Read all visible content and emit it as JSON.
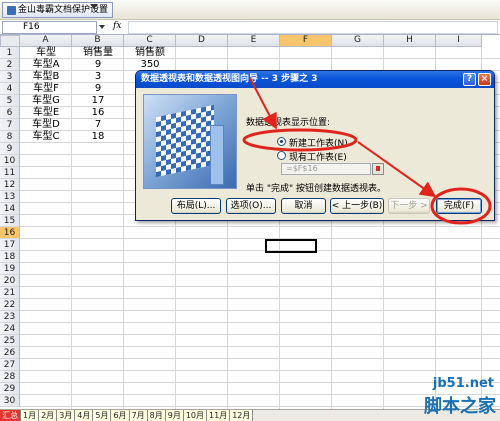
{
  "toolbar": {
    "protect_label": "金山毒霸文档保护设置"
  },
  "formula_bar": {
    "cell_ref": "F16",
    "fx_label": "fx",
    "formula": ""
  },
  "columns": [
    "A",
    "B",
    "C",
    "D",
    "E",
    "F",
    "G",
    "H",
    "I"
  ],
  "rows": [
    "1",
    "2",
    "3",
    "4",
    "5",
    "6",
    "7",
    "8",
    "9",
    "10",
    "11",
    "12",
    "13",
    "14",
    "15",
    "16",
    "17",
    "18",
    "19",
    "20",
    "21",
    "22",
    "23",
    "24",
    "25",
    "26",
    "27",
    "28",
    "29",
    "30"
  ],
  "selected": {
    "column": "F",
    "row": "16"
  },
  "sheet_data": {
    "headers": [
      "车型",
      "销售量",
      "销售额"
    ],
    "rows": [
      [
        "车型A",
        "9",
        "350"
      ],
      [
        "车型B",
        "3",
        ""
      ],
      [
        "车型F",
        "9",
        ""
      ],
      [
        "车型G",
        "17",
        ""
      ],
      [
        "车型E",
        "16",
        ""
      ],
      [
        "车型D",
        "7",
        ""
      ],
      [
        "车型C",
        "18",
        ""
      ]
    ]
  },
  "dialog": {
    "title": "数据透视表和数据透视图向导 -- 3 步骤之 3",
    "help_label": "?",
    "close_label": "×",
    "position_prompt": "数据透视表显示位置:",
    "options": [
      {
        "label": "新建工作表(N)",
        "selected": true
      },
      {
        "label": "现有工作表(E)",
        "selected": false
      }
    ],
    "range_value": "=$F$16",
    "hint": "单击 \"完成\" 按钮创建数据透视表。",
    "buttons": {
      "layout": "布局(L)...",
      "options": "选项(O)...",
      "cancel": "取消",
      "back": "< 上一步(B)",
      "next": "下一步 >",
      "finish": "完成(F)"
    }
  },
  "sheet_tabs": [
    "汇总",
    "1月",
    "2月",
    "3月",
    "4月",
    "5月",
    "6月",
    "7月",
    "8月",
    "9月",
    "10月",
    "11月",
    "12月"
  ],
  "watermark": {
    "site": "jb51.net",
    "name": "脚本之家"
  },
  "colors": {
    "annotation": "#e0251d",
    "title_bar": "#0a55d8",
    "selected_header": "#f7c56b"
  }
}
